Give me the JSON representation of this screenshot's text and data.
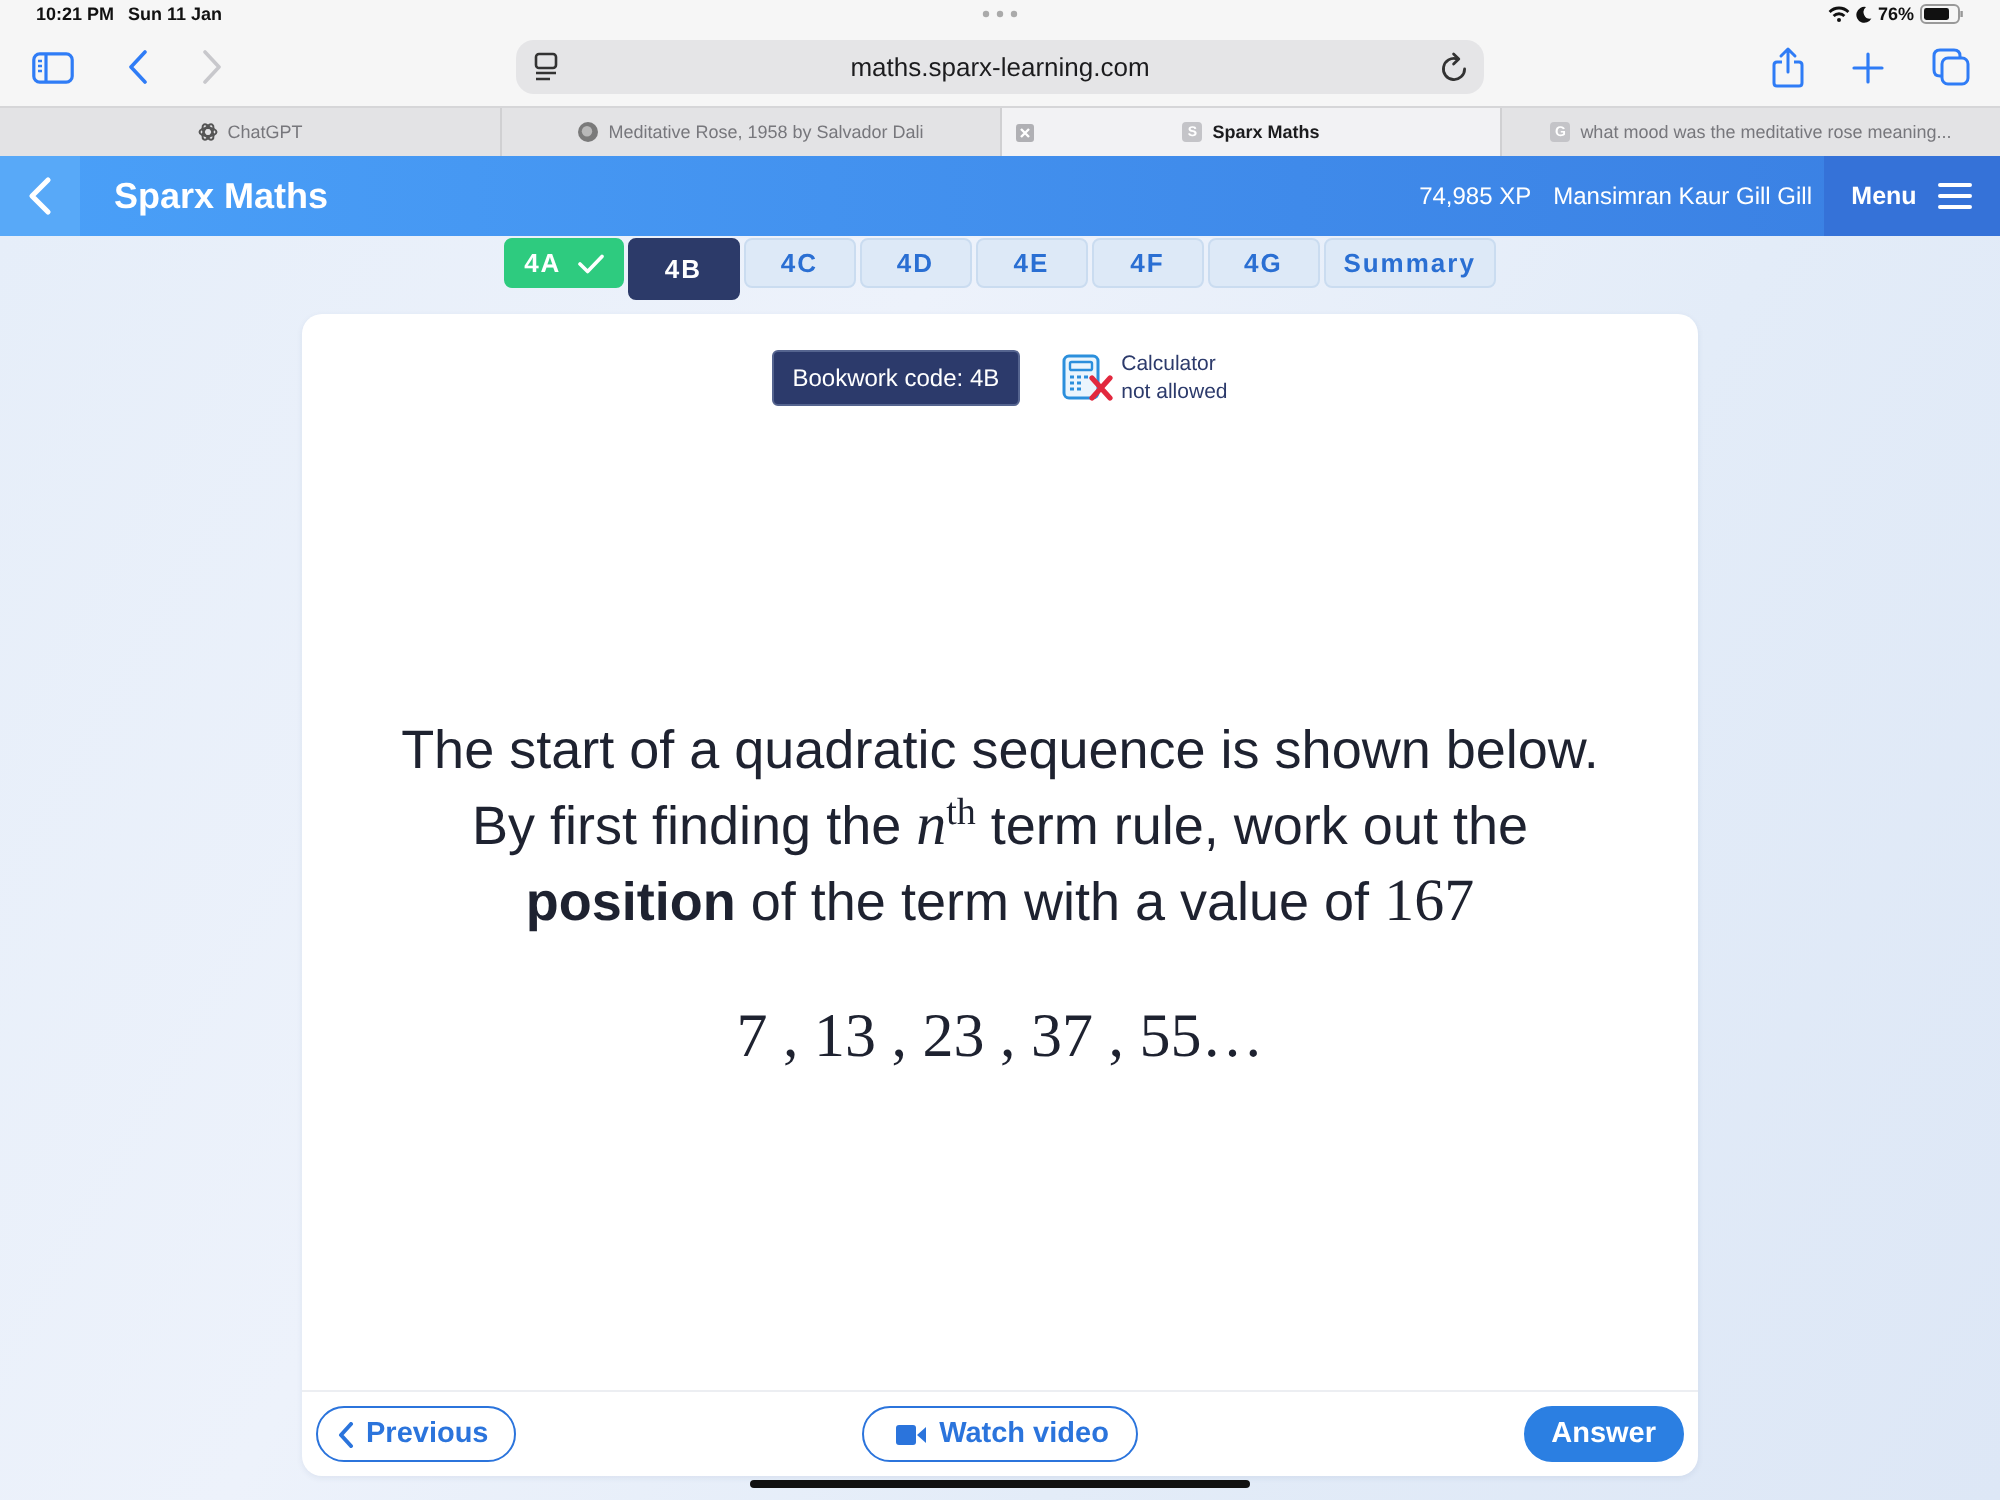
{
  "status_bar": {
    "time": "10:21 PM",
    "date": "Sun 11 Jan",
    "battery": "76%"
  },
  "browser": {
    "forward_disabled": true,
    "url": "maths.sparx-learning.com",
    "tabs": [
      {
        "kind": "logo",
        "title": "ChatGPT",
        "selected": false
      },
      {
        "kind": "image",
        "title": "Meditative Rose, 1958 by Salvador Dali",
        "selected": false
      },
      {
        "kind": "letter",
        "favicon": "S",
        "title": "Sparx Maths",
        "selected": true
      },
      {
        "kind": "letter",
        "favicon": "G",
        "title": "what mood was the meditative rose meaning...",
        "selected": false
      }
    ]
  },
  "header": {
    "title": "Sparx Maths",
    "xp": "74,985 XP",
    "user": "Mansimran Kaur Gill Gill",
    "menu": "Menu"
  },
  "task_tabs": [
    {
      "label": "4A",
      "selected": false,
      "done": true
    },
    {
      "label": "4B",
      "selected": true,
      "done": false
    },
    {
      "label": "4C",
      "selected": false,
      "done": false
    },
    {
      "label": "4D",
      "selected": false,
      "done": false
    },
    {
      "label": "4E",
      "selected": false,
      "done": false
    },
    {
      "label": "4F",
      "selected": false,
      "done": false
    },
    {
      "label": "4G",
      "selected": false,
      "done": false
    },
    {
      "label": "Summary",
      "selected": false,
      "done": false
    }
  ],
  "card": {
    "bookwork_code": "Bookwork code: 4B",
    "calculator": {
      "label": "Calculator",
      "status": "not allowed",
      "allowed": false
    },
    "question": {
      "intro": "The start of a quadratic sequence is shown below.",
      "task": "By first finding the *n*$^{th}$ term rule, work out the **position** of the term with a value of",
      "task_value": "167",
      "sequence": "7 , 13 , 23 , 37 , 55…"
    }
  },
  "footer": {
    "previous": "Previous",
    "watch_video": "Watch video",
    "answer": "Answer"
  }
}
